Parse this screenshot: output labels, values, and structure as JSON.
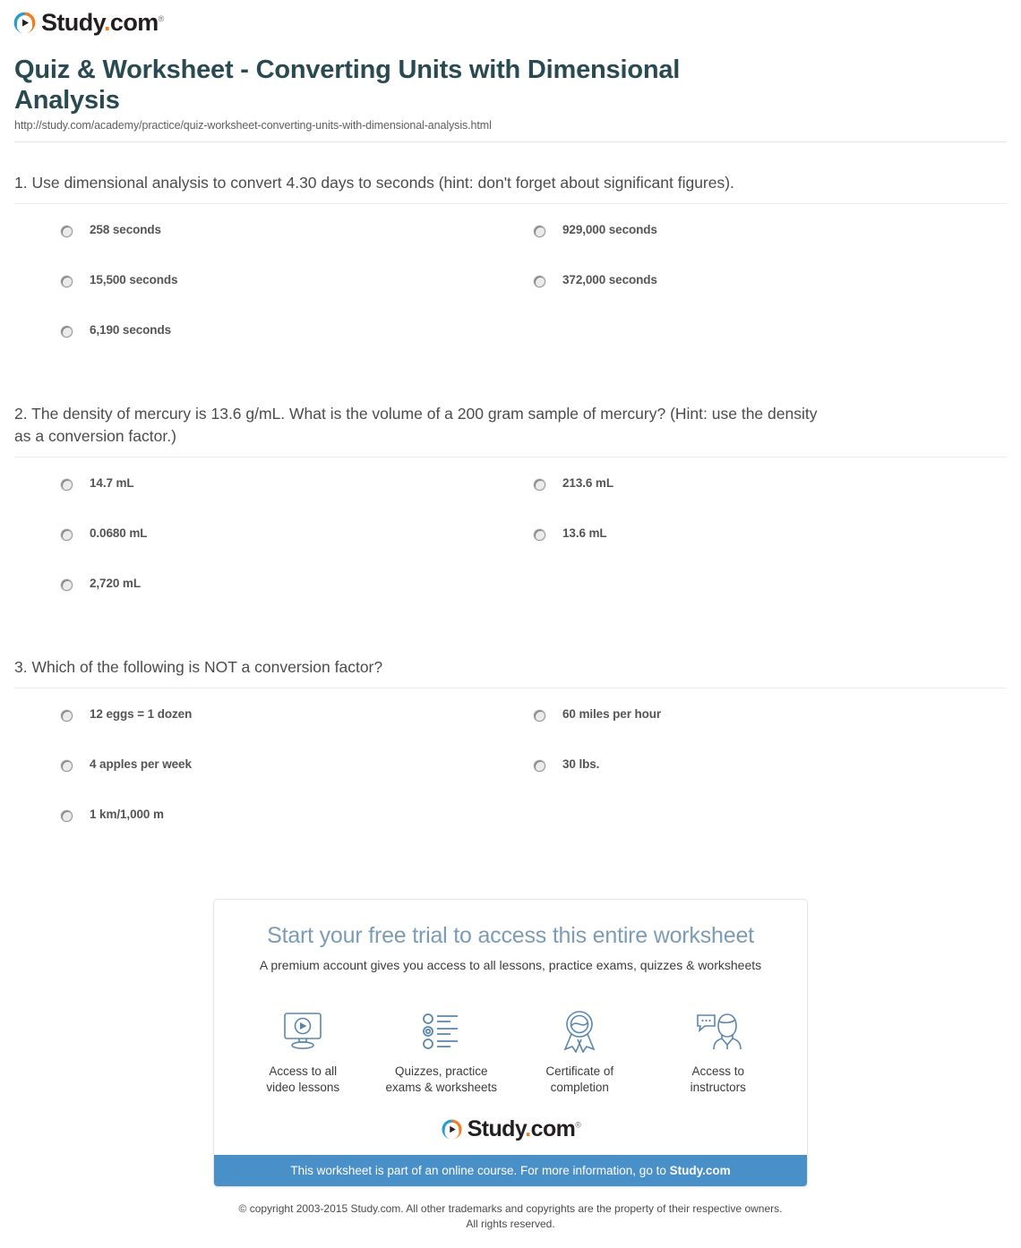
{
  "brand": {
    "name_main": "Study",
    "name_dot": ".",
    "name_tld": "com",
    "trademark": "®",
    "colors": {
      "logo_blue": "#2b9ccc",
      "logo_orange": "#f07d22",
      "title_teal": "#2a4a52",
      "bar_blue": "#4a90c8"
    }
  },
  "header": {
    "title": "Quiz & Worksheet - Converting Units with Dimensional Analysis",
    "url": "http://study.com/academy/practice/quiz-worksheet-converting-units-with-dimensional-analysis.html"
  },
  "questions": [
    {
      "text": "1. Use dimensional analysis to convert 4.30 days to seconds (hint: don't forget about significant figures).",
      "options": [
        "258 seconds",
        "929,000 seconds",
        "15,500 seconds",
        "372,000 seconds",
        "6,190 seconds"
      ]
    },
    {
      "text": "2. The density of mercury is 13.6 g/mL. What is the volume of a 200 gram sample of mercury? (Hint: use the density as a conversion factor.)",
      "options": [
        "14.7 mL",
        "213.6 mL",
        "0.0680 mL",
        "13.6 mL",
        "2,720 mL"
      ]
    },
    {
      "text": "3. Which of the following is NOT a conversion factor?",
      "options": [
        "12 eggs = 1 dozen",
        "60 miles per hour",
        "4 apples per week",
        "30 lbs.",
        "1 km/1,000 m"
      ]
    }
  ],
  "promo": {
    "title": "Start your free trial to access this entire worksheet",
    "subtitle": "A premium account gives you access to all lessons, practice exams, quizzes & worksheets",
    "features": [
      {
        "icon": "monitor-play-icon",
        "label": "Access to all\nvideo lessons"
      },
      {
        "icon": "quiz-list-icon",
        "label": "Quizzes, practice\nexams & worksheets"
      },
      {
        "icon": "certificate-ribbon-icon",
        "label": "Certificate of\ncompletion"
      },
      {
        "icon": "instructor-chat-icon",
        "label": "Access to\ninstructors"
      }
    ],
    "bar_text": "This worksheet is part of an online course. For more information, go to ",
    "bar_link": "Study.com"
  },
  "footer": {
    "copyright": "© copyright 2003-2015 Study.com. All other trademarks and copyrights are the property of their respective owners.\nAll rights reserved."
  }
}
